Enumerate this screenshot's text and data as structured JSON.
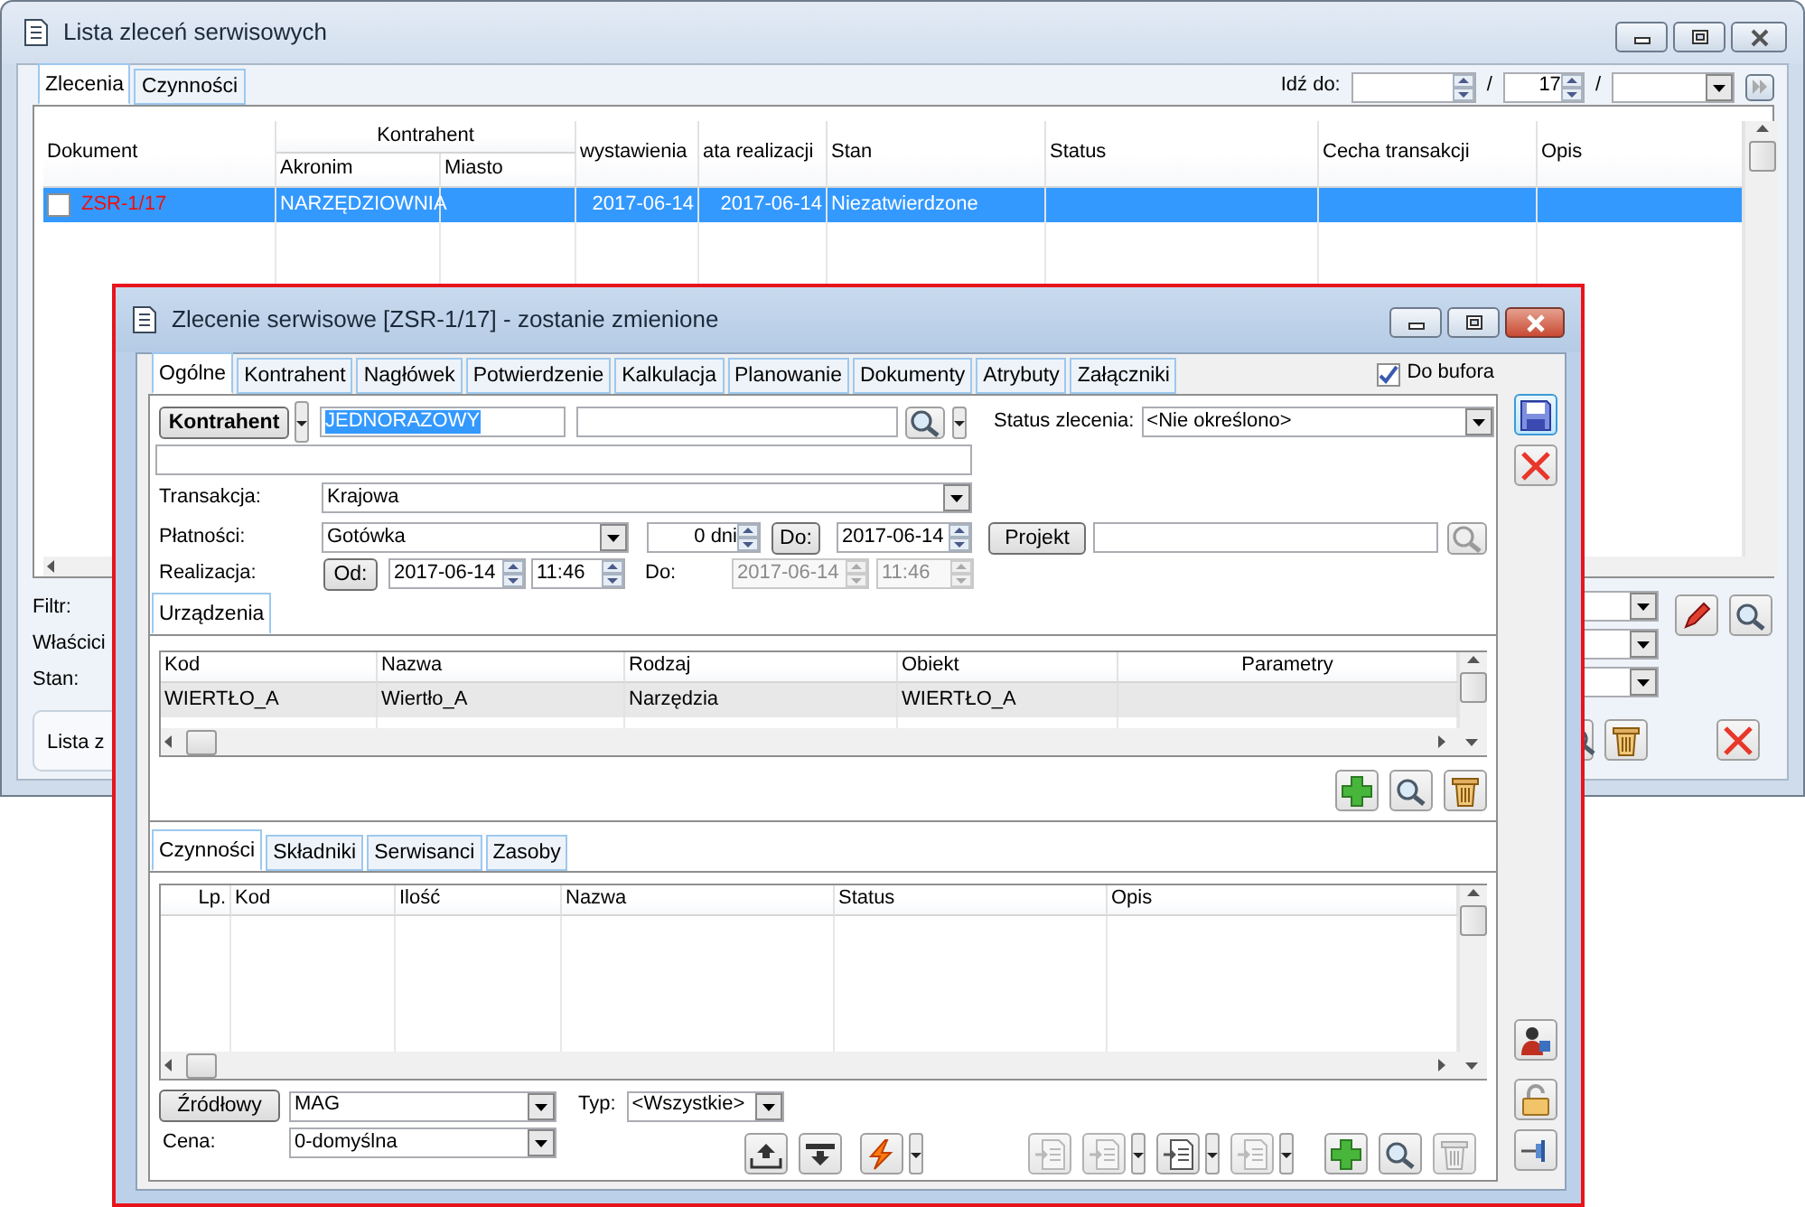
{
  "back_window": {
    "title": "Lista zleceń serwisowych",
    "tabs": [
      {
        "label": "Zlecenia",
        "selected": true
      },
      {
        "label": "Czynności",
        "selected": false
      }
    ],
    "goto": {
      "label": "Idź do:",
      "separators": [
        "/",
        "/"
      ],
      "count": "17"
    },
    "table": {
      "group_header": "Kontrahent",
      "columns": [
        "Dokument",
        "Akronim",
        "Miasto",
        "wystawienia",
        "ata realizacji",
        "Stan",
        "Status",
        "Cecha transakcji",
        "Opis"
      ],
      "rows": [
        {
          "selected": true,
          "checked": false,
          "document": "ZSR-1/17",
          "akronim": "NARZĘDZIOWNIA",
          "issue_date": "2017-06-14",
          "due_date": "2017-06-14",
          "state": "Niezatwierdzone"
        }
      ]
    },
    "filter_labels": [
      "Filtr:",
      "Właścici",
      "Stan:"
    ],
    "list_button": "Lista z"
  },
  "dialog": {
    "title": "Zlecenie serwisowe [ZSR-1/17]  - zostanie zmienione",
    "tabs": [
      {
        "label": "Ogólne",
        "selected": true
      },
      {
        "label": "Kontrahent",
        "selected": false
      },
      {
        "label": "Nagłówek",
        "selected": false
      },
      {
        "label": "Potwierdzenie",
        "selected": false
      },
      {
        "label": "Kalkulacja",
        "selected": false
      },
      {
        "label": "Planowanie",
        "selected": false
      },
      {
        "label": "Dokumenty",
        "selected": false
      },
      {
        "label": "Atrybuty",
        "selected": false
      },
      {
        "label": "Załączniki",
        "selected": false
      }
    ],
    "buffer": {
      "label": "Do bufora",
      "checked": true
    },
    "kontrahent": {
      "button": "Kontrahent",
      "code": "JEDNORAZOWY"
    },
    "status": {
      "label": "Status zlecenia:",
      "value": "<Nie określono>"
    },
    "transakcja": {
      "label": "Transakcja:",
      "value": "Krajowa"
    },
    "platnosci": {
      "label": "Płatności:",
      "value": "Gotówka",
      "days": "0 dni",
      "due_button": "Do:",
      "date": "2017-06-14",
      "project_button": "Projekt"
    },
    "realizacja": {
      "label": "Realizacja:",
      "from_button": "Od:",
      "from_date": "2017-06-14",
      "from_time": "11:46",
      "to_label": "Do:",
      "to_date": "2017-06-14",
      "to_time": "11:46",
      "to_disabled": true
    },
    "devices": {
      "tabs": [
        {
          "label": "Urządzenia",
          "selected": true
        }
      ],
      "columns": [
        "Kod",
        "Nazwa",
        "Rodzaj",
        "Obiekt",
        "Parametry"
      ],
      "rows": [
        {
          "selected": true,
          "cells": [
            "WIERTŁO_A",
            "Wiertło_A",
            "Narzędzia",
            "WIERTŁO_A"
          ]
        }
      ]
    },
    "activities": {
      "tabs": [
        {
          "label": "Czynności",
          "selected": true
        },
        {
          "label": "Składniki",
          "selected": false
        },
        {
          "label": "Serwisanci",
          "selected": false
        },
        {
          "label": "Zasoby",
          "selected": false
        }
      ],
      "columns": [
        "Lp.",
        "Kod",
        "Ilość",
        "Nazwa",
        "Status",
        "Opis"
      ]
    },
    "source": {
      "button": "Źródłowy",
      "value": "MAG",
      "type_label": "Typ:",
      "type_value": "<Wszystkie>",
      "price_label": "Cena:",
      "price_value": "0-domyślna"
    },
    "toolbar": [
      {
        "kind": "upload",
        "disabled": false
      },
      {
        "kind": "download",
        "disabled": false
      },
      {
        "kind": "lightning",
        "disabled": false,
        "menu": true
      },
      {
        "kind": "doc",
        "disabled": true
      },
      {
        "kind": "doc",
        "disabled": true,
        "menu": true
      },
      {
        "kind": "doc",
        "disabled": false,
        "menu": true
      },
      {
        "kind": "doc",
        "disabled": true,
        "menu": true
      },
      {
        "kind": "add",
        "disabled": false
      },
      {
        "kind": "search",
        "disabled": false
      },
      {
        "kind": "trash",
        "disabled": true
      }
    ]
  }
}
